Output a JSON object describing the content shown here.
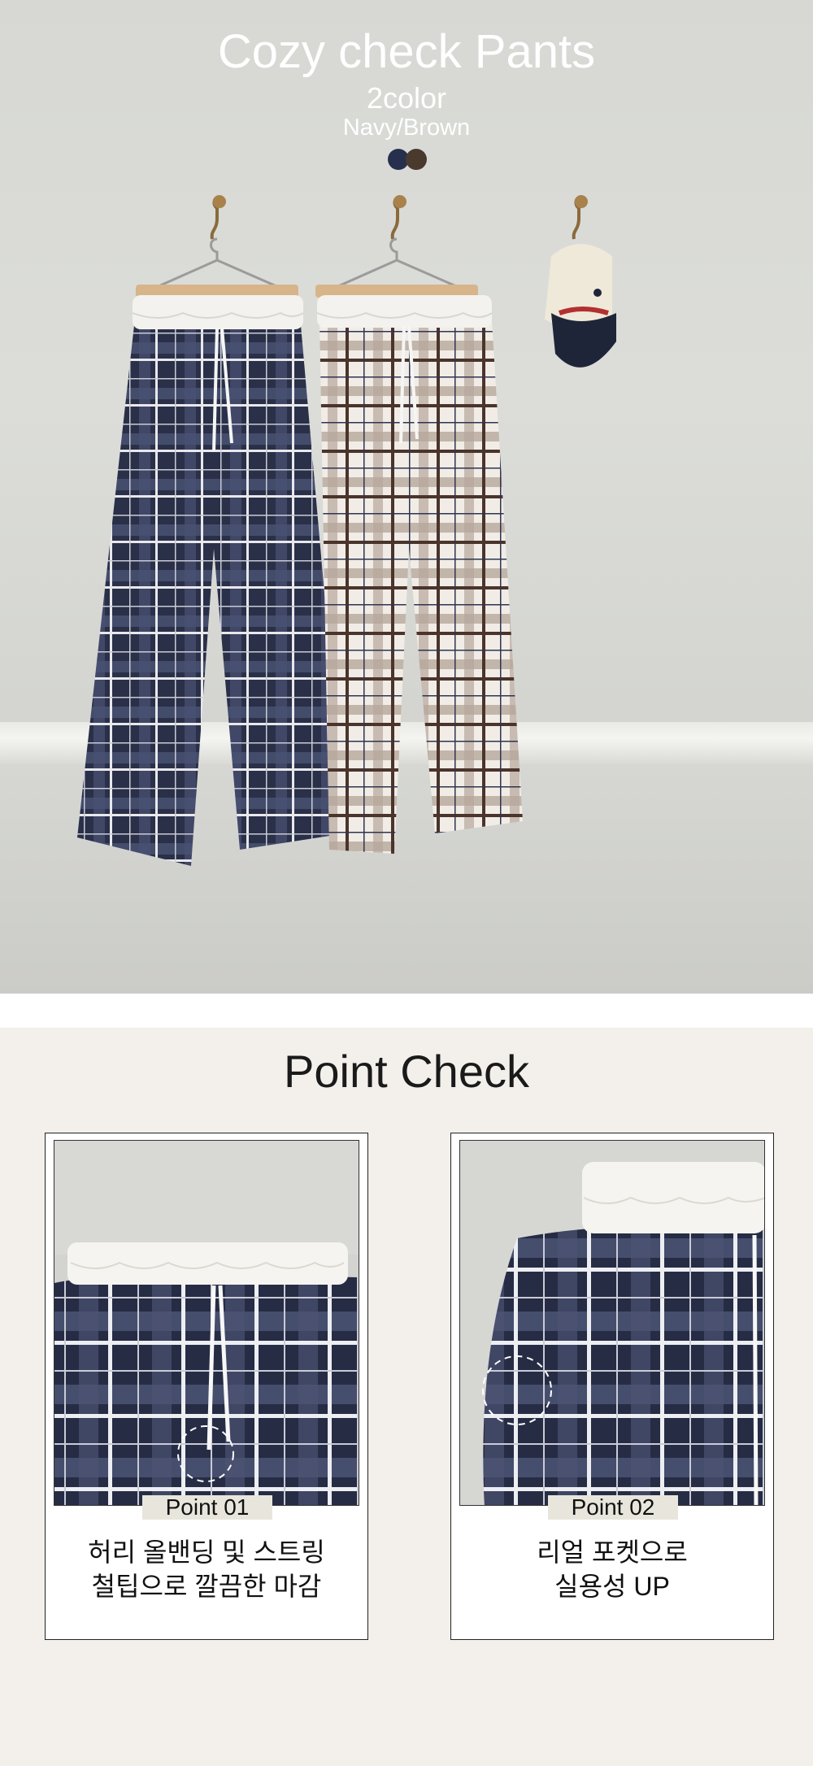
{
  "hero": {
    "title": "Cozy check Pants",
    "subtitle": "2color",
    "colors_text": "Navy/Brown",
    "swatches": [
      "#26304d",
      "#4a3a2e"
    ]
  },
  "point_check": {
    "title": "Point Check",
    "points": [
      {
        "tag": "Point 01",
        "line1": "허리 올밴딩 및 스트링",
        "line2": "철팁으로 깔끔한 마감"
      },
      {
        "tag": "Point 02",
        "line1": "리얼 포켓으로",
        "line2": "실용성 UP"
      }
    ]
  }
}
